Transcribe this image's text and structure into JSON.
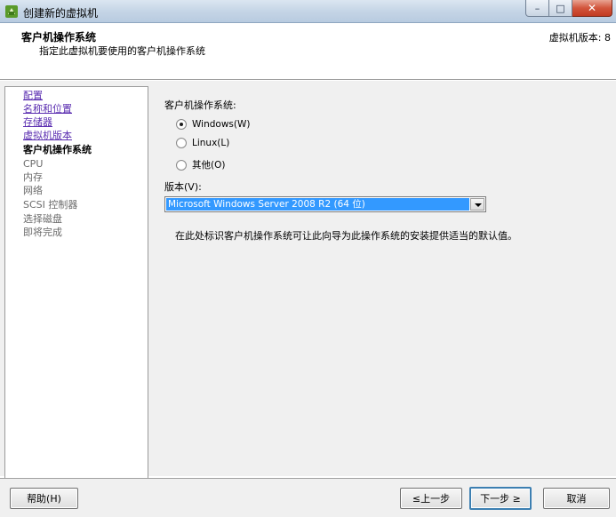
{
  "window": {
    "title": "创建新的虚拟机",
    "minimize_symbol": "–",
    "maximize_symbol": "□",
    "close_symbol": "✕"
  },
  "header": {
    "title": "客户机操作系统",
    "subtitle": "指定此虚拟机要使用的客户机操作系统",
    "version": "虚拟机版本: 8"
  },
  "nav": {
    "items": [
      {
        "label": "配置",
        "state": "link"
      },
      {
        "label": "名称和位置",
        "state": "link"
      },
      {
        "label": "存储器",
        "state": "link"
      },
      {
        "label": "虚拟机版本",
        "state": "link"
      },
      {
        "label": "客户机操作系统",
        "state": "active"
      },
      {
        "label": "CPU",
        "state": "pending"
      },
      {
        "label": "内存",
        "state": "pending"
      },
      {
        "label": "网络",
        "state": "pending"
      },
      {
        "label": "SCSI 控制器",
        "state": "pending"
      },
      {
        "label": "选择磁盘",
        "state": "pending"
      },
      {
        "label": "即将完成",
        "state": "pending"
      }
    ]
  },
  "main": {
    "os_label": "客户机操作系统:",
    "os_options": [
      {
        "label": "Windows(W)",
        "checked": true
      },
      {
        "label": "Linux(L)",
        "checked": false
      },
      {
        "label": "其他(O)",
        "checked": false
      }
    ],
    "version_label": "版本(V):",
    "version_selected": "Microsoft Windows Server 2008 R2 (64 位)",
    "hint": "在此处标识客户机操作系统可让此向导为此操作系统的安装提供适当的默认值。"
  },
  "footer": {
    "help_label": "帮助(H)",
    "back_label": "≤上一步",
    "next_label": "下一步 ≥",
    "cancel_label": "取消"
  },
  "colors": {
    "link": "#5a2db0",
    "selection": "#3399ff",
    "close_button": "#c13a21"
  }
}
